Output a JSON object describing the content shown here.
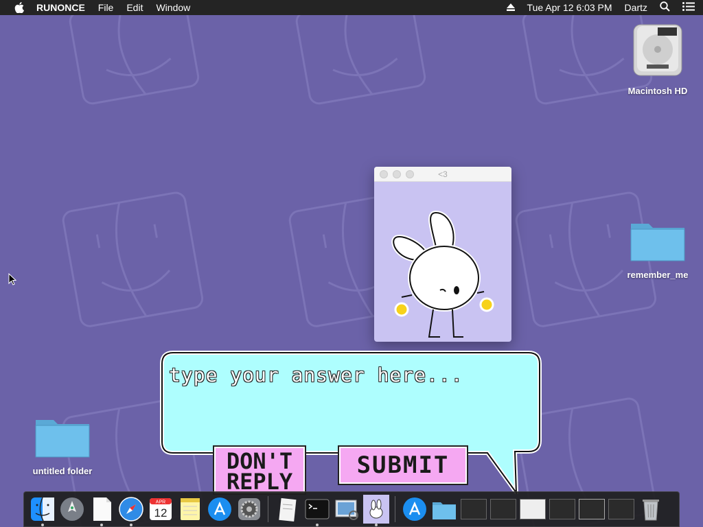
{
  "menubar": {
    "app_name": "RUNONCE",
    "menus": [
      "File",
      "Edit",
      "Window"
    ],
    "datetime": "Tue Apr 12  6:03 PM",
    "user": "Dartz"
  },
  "desktop": {
    "icons": [
      {
        "label": "Macintosh HD"
      },
      {
        "label": "remember_me"
      },
      {
        "label": "untitled folder"
      }
    ]
  },
  "window": {
    "title": "<3"
  },
  "dialog": {
    "placeholder": "type your answer here...",
    "dont_reply": "DON'T REPLY",
    "submit": "SUBMIT"
  },
  "dock": {
    "calendar_month": "APR",
    "calendar_day": "12",
    "items": [
      "Finder",
      "Launchpad",
      "TextEdit",
      "Safari",
      "Calendar",
      "Notes",
      "App Store",
      "System Preferences",
      "TextEdit Document",
      "Terminal",
      "Preview",
      "RUNONCE",
      "App Store Downloads",
      "Folder",
      "Window",
      "Window",
      "Window",
      "Window",
      "Window",
      "Window",
      "Trash"
    ]
  },
  "colors": {
    "wallpaper": "#6b62a8",
    "bubble": "#aefefe",
    "button": "#f5a8f2",
    "window_bg": "#c9c3f2"
  }
}
